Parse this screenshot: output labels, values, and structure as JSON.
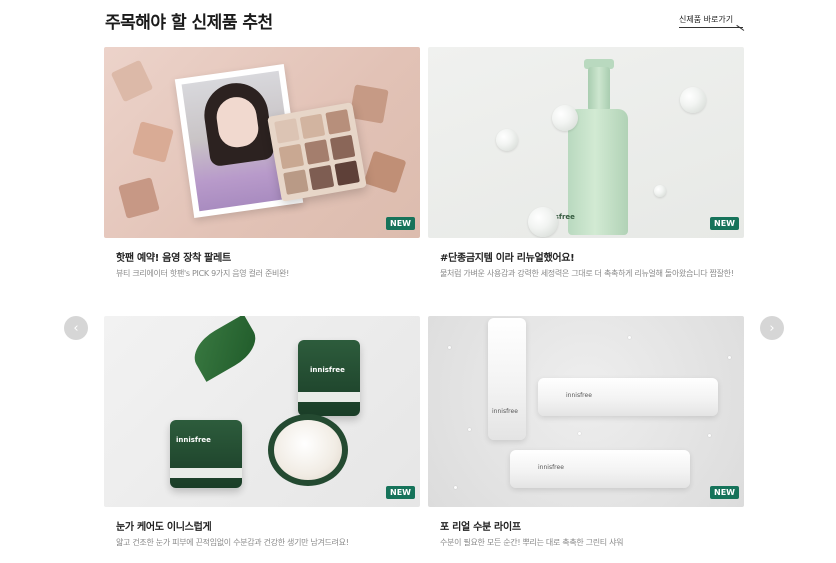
{
  "section": {
    "title": "주목해야 할 신제품 추천",
    "more_label": "신제품 바로가기"
  },
  "badge_label": "NEW",
  "nav": {
    "prev_icon": "‹",
    "next_icon": "›"
  },
  "cards": [
    {
      "title": "핫팬 예약! 음영 장착 팔레트",
      "desc": "뷰티 크리에이터 핫팬's PICK 9가지 음영 컬러 준비완!"
    },
    {
      "title": "#단종금지템 이라 리뉴얼했어요!",
      "desc": "물처럼 가벼운 사용감과 강력한 세정력은 그대로 더 촉촉하게 리뉴얼해 돌아왔습니다 짭잘한!",
      "image_text": "innisfree"
    },
    {
      "title": "눈가 케어도 이니스럽게",
      "desc": "얇고 건조한 눈가 피부에 끈적임없이 수분감과 건강한 생기만 남겨드려요!",
      "image_text": "innisfree"
    },
    {
      "title": "포 리얼 수분 라이프",
      "desc": "수분이 필요한 모든 순간! 뿌리는 대로 촉촉한 그린티 샤워",
      "image_text": "innisfree"
    }
  ],
  "colors": {
    "badge": "#16735a",
    "nav_button": "#d6d6d6"
  }
}
